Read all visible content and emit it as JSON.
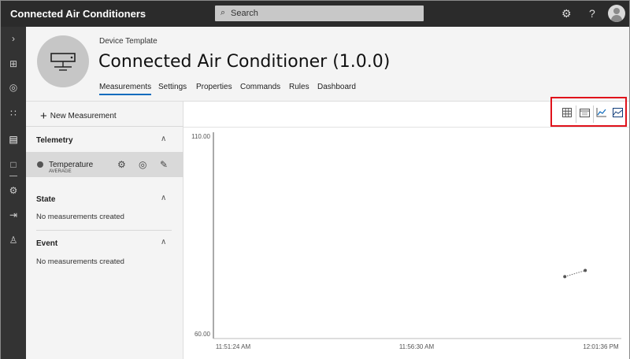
{
  "topbar": {
    "app_title": "Connected Air Conditioners",
    "search_placeholder": "Search",
    "search_icon": "search-icon",
    "settings_icon": "gear-icon",
    "help_label": "?"
  },
  "rail": {
    "items": [
      "chevron-right-icon",
      "dashboard-icon",
      "device-explorer-icon",
      "device-sets-icon",
      "analytics-icon",
      "device-templates-icon",
      "jobs-icon",
      "data-export-icon",
      "administration-icon"
    ]
  },
  "header": {
    "template_label": "Device Template",
    "title": "Connected Air Conditioner  (1.0.0)",
    "tabs": [
      "Measurements",
      "Settings",
      "Properties",
      "Commands",
      "Rules",
      "Dashboard"
    ],
    "active_tab": "Measurements"
  },
  "panel": {
    "new_measurement_label": "New Measurement",
    "sections": [
      {
        "title": "Telemetry",
        "items": [
          {
            "name": "Temperature",
            "aggregation": "AVERAGE"
          }
        ]
      },
      {
        "title": "State",
        "empty_text": "No measurements created"
      },
      {
        "title": "Event",
        "empty_text": "No measurements created"
      }
    ]
  },
  "chart_toolbar": {
    "buttons": [
      "grid-view-icon",
      "calendar-icon",
      "line-chart-icon",
      "image-chart-icon"
    ],
    "highlight_color": "#e0121b"
  },
  "chart_data": {
    "type": "line",
    "title": "",
    "xlabel": "",
    "ylabel": "",
    "ylim": [
      60.0,
      110.0
    ],
    "y_ticks": [
      "110.00",
      "60.00"
    ],
    "x_ticks": [
      "11:51:24 AM",
      "11:56:30 AM",
      "12:01:36 PM"
    ],
    "series": [
      {
        "x": [
          "12:00:36 PM",
          "12:01:10 PM"
        ],
        "values": [
          75.0,
          76.5
        ]
      }
    ]
  }
}
